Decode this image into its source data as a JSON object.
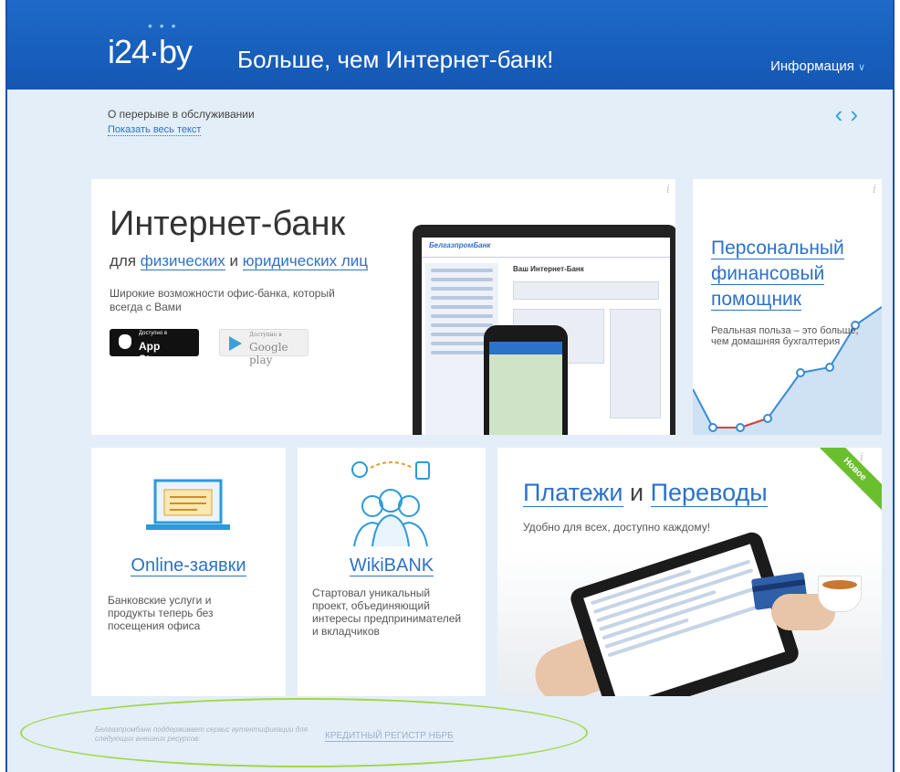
{
  "header": {
    "logo": "i24·by",
    "tagline": "Больше, чем Интернет-банк!",
    "info_menu": "Информация"
  },
  "notice": {
    "text": "О перерыве в обслуживании",
    "link": "Показать весь текст"
  },
  "nav": {
    "prev": "‹",
    "next": "›"
  },
  "internet_bank": {
    "title": "Интернет-банк",
    "sub_prefix": "для ",
    "sub_link1": "физических",
    "sub_mid": " и ",
    "sub_link2": "юридических лиц",
    "description": "Широкие возможности офис-банка, который всегда с Вами",
    "appstore_small": "Доступно в",
    "appstore": "App Store",
    "gplay_small": "Доступно в",
    "gplay": "Google play",
    "screen_bank": "БелгазпромБанк",
    "screen_title": "Ваш Интернет-Банк"
  },
  "personal_finance": {
    "title_line1": "Персональный",
    "title_line2": "финансовый",
    "title_line3": "помощник",
    "description": "Реальная польза – это больше, чем домашняя бухгалтерия"
  },
  "online_requests": {
    "title": "Online-заявки",
    "description": "Банковские услуги и продукты теперь без посещения офиса"
  },
  "wikibank": {
    "title": "WikiBANK",
    "description": "Стартовал уникальный проект, объединяющий интересы предпринимателей и вкладчиков"
  },
  "payments": {
    "title_link1": "Платежи",
    "title_mid": " и ",
    "title_link2": "Переводы",
    "subtitle": "Удобно для всех, доступно каждому!",
    "ribbon": "Новое"
  },
  "footer": {
    "note": "Белгазпромбанк поддерживает сервис аутентификации для следующих внешних ресурсов:",
    "link": "КРЕДИТНЫЙ РЕГИСТР НБРБ"
  },
  "info_icon": "i",
  "colors": {
    "header": "#1e6ac8",
    "link": "#2c72c9",
    "accent_green": "#6abf2e",
    "oval": "#a3d64a"
  }
}
